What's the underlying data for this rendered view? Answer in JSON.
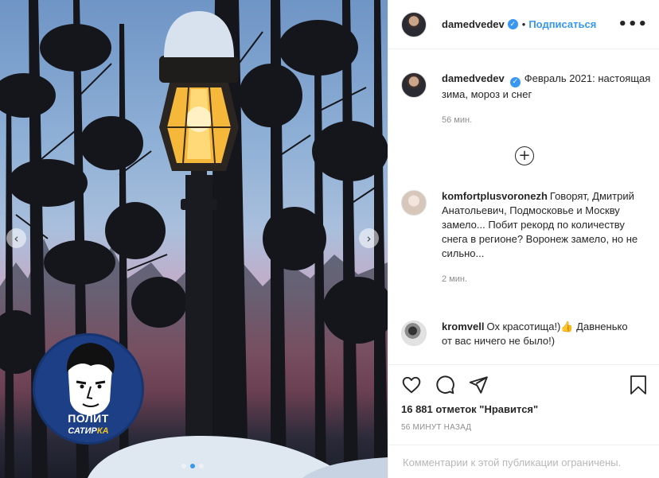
{
  "post": {
    "nav_prev": "‹",
    "nav_next": "›",
    "slide_count": 3,
    "active_slide": 2,
    "watermark": {
      "line1": "ПОЛИТ",
      "line2_a": "САТИР",
      "line2_b": "КА"
    }
  },
  "header": {
    "username": "damedvedev",
    "verified_mark": "✓",
    "separator": "•",
    "follow_label": "Подписаться",
    "more_label": "•••"
  },
  "caption": {
    "author": "damedvedev",
    "text": "Февраль 2021: настоящая зима, мороз и снег",
    "time": "56 мин."
  },
  "load_more_label": "+",
  "comments": [
    {
      "author": "komfortplusvoronezh",
      "text": "Говорят, Дмитрий Анатольевич, Подмосковье и Москву замело... Побит рекорд по количеству снега в регионе? Воронеж замело, но не сильно...",
      "time": "2 мин."
    },
    {
      "author": "kromvell",
      "text": "Ох красотища!)👍 Давненько от вас ничего не было!)"
    }
  ],
  "actions": {
    "like_icon": "heart-icon",
    "comment_icon": "comment-icon",
    "share_icon": "share-icon",
    "save_icon": "bookmark-icon",
    "likes_text": "16 881 отметок \"Нравится\"",
    "posted_time": "56 минут назад",
    "comments_restricted": "Комментарии к этой публикации ограничены."
  },
  "colors": {
    "accent": "#3897f0",
    "watermark_bg": "#1d3f86",
    "watermark_highlight": "#f3c21c",
    "lamp_glow": "#f5b83a"
  }
}
